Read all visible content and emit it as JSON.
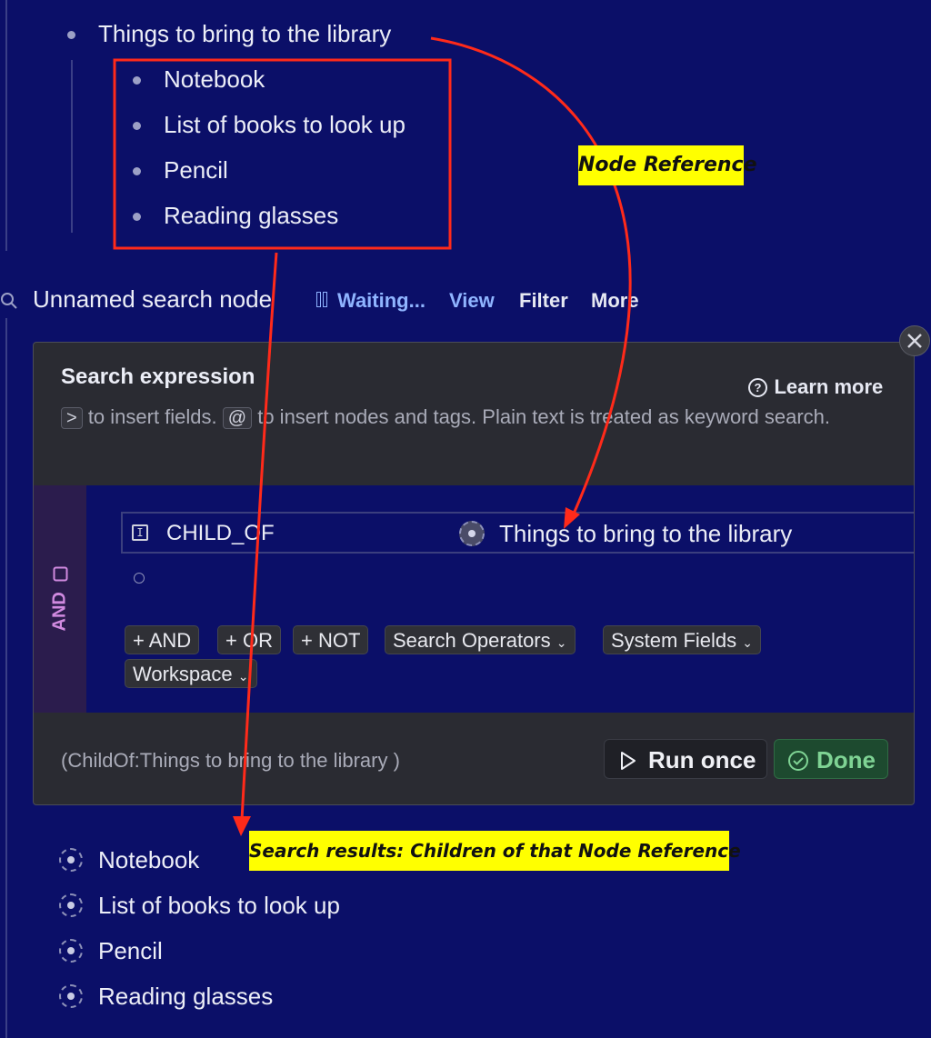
{
  "outline": {
    "parent": "Things to bring to the library",
    "children": [
      "Notebook",
      "List of books to look up",
      "Pencil",
      "Reading glasses"
    ]
  },
  "search_node": {
    "title": "Unnamed search node",
    "status": "Waiting...",
    "view": "View",
    "filter": "Filter",
    "more": "More"
  },
  "panel": {
    "heading": "Search expression",
    "learn_more": "Learn more",
    "hint_key1": ">",
    "hint_part1": "to insert fields.",
    "hint_key2": "@",
    "hint_part2": "to insert nodes and tags. Plain text is treated as keyword",
    "hint_part3": "search.",
    "and_label": "AND",
    "field_name": "CHILD_OF",
    "field_value": "Things to bring to the library",
    "chips": {
      "and": "+ AND",
      "or": "+ OR",
      "not": "+ NOT",
      "operators": "Search Operators",
      "system_fields": "System Fields",
      "workspace": "Workspace"
    },
    "query": "(ChildOf:Things to bring to the library )",
    "run_once": "Run once",
    "done": "Done"
  },
  "results": [
    "Notebook",
    "List of books to look up",
    "Pencil",
    "Reading glasses"
  ],
  "annotations": {
    "node_reference": "Node Reference",
    "search_results": "Search results: Children of that Node Reference"
  },
  "colors": {
    "background": "#0b0f68",
    "annotation_red": "#ff2a1a",
    "annotation_yellow": "#ffff00",
    "link_blue": "#8fb4ff",
    "done_green": "#7fd394"
  }
}
